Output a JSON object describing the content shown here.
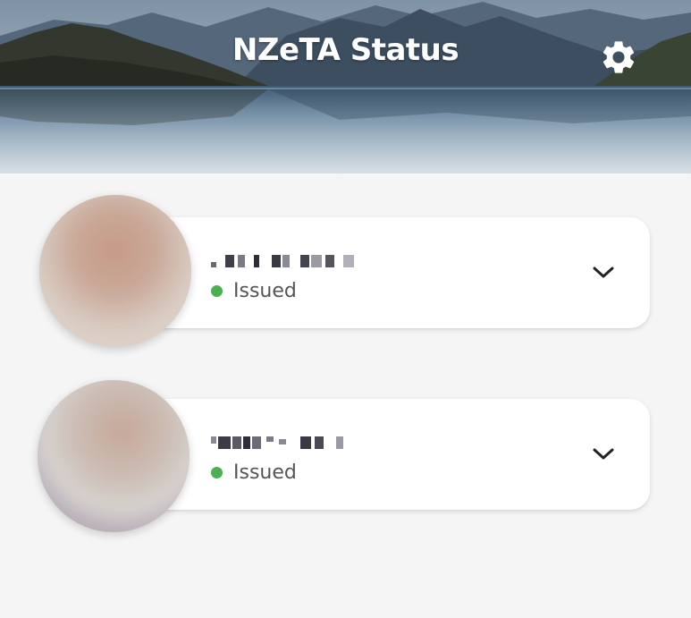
{
  "header": {
    "title": "NZeTA Status",
    "settings_icon": "gear-icon"
  },
  "colors": {
    "page_background": "#f5f5f5",
    "card_background": "#ffffff",
    "status_dot": "#4caf50",
    "status_text": "#555555",
    "title_text": "#ffffff"
  },
  "applications": [
    {
      "name_redacted": true,
      "status": "Issued",
      "expand_icon": "chevron-down-icon"
    },
    {
      "name_redacted": true,
      "status": "Issued",
      "expand_icon": "chevron-down-icon"
    }
  ]
}
